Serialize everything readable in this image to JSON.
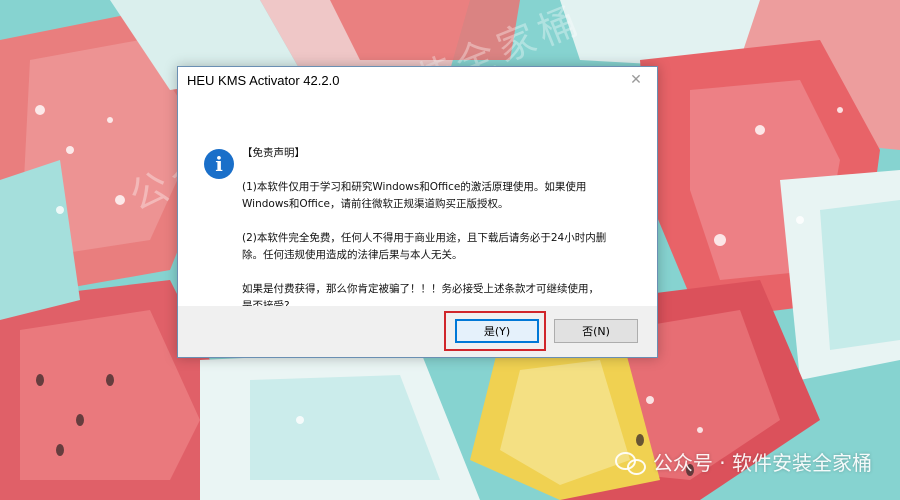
{
  "dialog": {
    "title": "HEU KMS Activator 42.2.0",
    "close_glyph": "✕",
    "icon": "info-icon",
    "icon_glyph": "i",
    "message": {
      "heading": "【免责声明】",
      "line1": "(1)本软件仅用于学习和研究Windows和Office的激活原理使用。如果使用",
      "line2": "Windows和Office，请前往微软正规渠道购买正版授权。",
      "line3": "(2)本软件完全免费，任何人不得用于商业用途，且下载后请务必于24小时内删",
      "line4": "除。任何违规使用造成的法律后果与本人无关。",
      "line5": "如果是付费获得，那么你肯定被骗了！！！务必接受上述条款才可继续使用，",
      "line6": "是否接受?"
    },
    "buttons": {
      "yes_label": "是(Y)",
      "no_label": "否(N)"
    },
    "highlight_color": "#d0262b"
  },
  "watermark": {
    "diagonal_text": "公众号：软件安装全家桶",
    "corner_text": "公众号 · 软件安装全家桶",
    "corner_icon": "wechat-icon"
  },
  "colors": {
    "info_icon_blue": "#1a6fc9",
    "default_button_border": "#0078d7",
    "footer_bg": "#f0f0f0",
    "background_teal": "#7fcfcf"
  }
}
